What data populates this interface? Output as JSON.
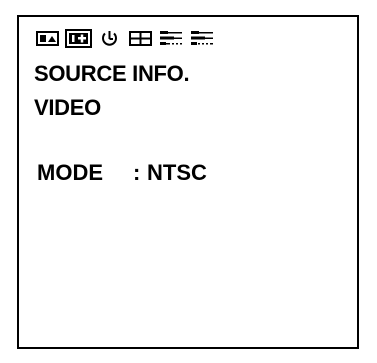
{
  "tabs": [
    {
      "icon": "picture-adjust-icon",
      "active": false
    },
    {
      "icon": "source-info-icon",
      "active": true
    },
    {
      "icon": "power-timer-icon",
      "active": false
    },
    {
      "icon": "screen-layout-icon",
      "active": false
    },
    {
      "icon": "setup-sliders-icon",
      "active": false
    },
    {
      "icon": "setup-sliders-alt-icon",
      "active": false
    }
  ],
  "screen": {
    "title": "SOURCE INFO.",
    "subtitle": "VIDEO",
    "fields": [
      {
        "label": "MODE",
        "separator": ":",
        "value": "NTSC"
      }
    ]
  },
  "colors": {
    "foreground": "#000000",
    "background": "#ffffff"
  }
}
